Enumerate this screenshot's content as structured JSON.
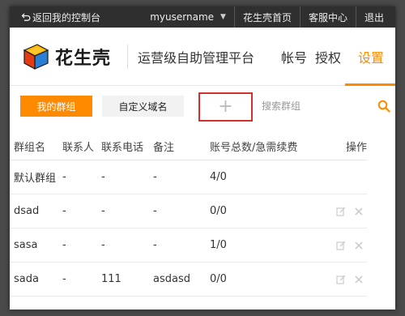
{
  "topbar": {
    "back_label": "返回我的控制台",
    "username": "myusername",
    "home_link": "花生壳首页",
    "support_link": "客服中心",
    "logout_link": "退出"
  },
  "header": {
    "brand_name": "花生壳",
    "platform_title": "运营级自助管理平台",
    "nav": [
      {
        "label": "帐号"
      },
      {
        "label": "授权"
      },
      {
        "label": "设置",
        "active": true
      }
    ]
  },
  "toolbar": {
    "my_groups_label": "我的群组",
    "custom_domain_label": "自定义域名",
    "add_symbol": "+",
    "search_placeholder": "搜索群组"
  },
  "table": {
    "headers": [
      "群组名",
      "联系人",
      "联系电话",
      "备注",
      "账号总数/急需续费",
      "操作"
    ],
    "rows": [
      {
        "name": "默认群组",
        "contact": "-",
        "phone": "-",
        "note": "-",
        "accounts": "4/0",
        "editable": false
      },
      {
        "name": "dsad",
        "contact": "-",
        "phone": "-",
        "note": "-",
        "accounts": "0/0",
        "editable": true
      },
      {
        "name": "sasa",
        "contact": "-",
        "phone": "-",
        "note": "-",
        "accounts": "1/0",
        "editable": true
      },
      {
        "name": "sada",
        "contact": "-",
        "phone": "111",
        "note": "asdasd",
        "accounts": "0/0",
        "editable": true
      }
    ]
  },
  "colors": {
    "accent": "#ff8a00",
    "topbar_bg": "#2f2f2f",
    "highlight_border": "#d32f2f"
  }
}
